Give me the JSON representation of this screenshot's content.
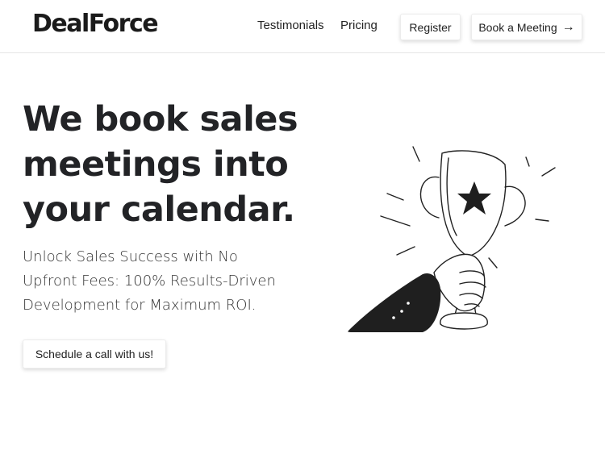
{
  "header": {
    "logo": "DealForce",
    "nav": [
      {
        "label": "Testimonials"
      },
      {
        "label": "Pricing"
      }
    ],
    "register_label": "Register",
    "book_label": "Book a Meeting",
    "book_icon": "arrow-right-icon"
  },
  "hero": {
    "title": "We book sales meetings into your calendar.",
    "subtitle": "Unlock Sales Success with No Upfront Fees: 100% Results-Driven Development for Maximum ROI.",
    "cta_label": "Schedule a call with us!",
    "illustration": "trophy-hand-icon"
  },
  "colors": {
    "text": "#222326",
    "sleeve": "#1f1f1f",
    "background": "#ffffff"
  }
}
